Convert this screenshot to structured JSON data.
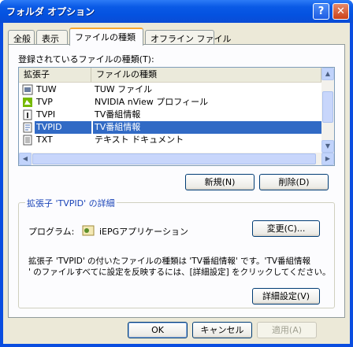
{
  "window": {
    "title": "フォルダ オプション",
    "help_glyph": "?",
    "close_glyph": "✕"
  },
  "tabs": [
    {
      "label": "全般"
    },
    {
      "label": "表示"
    },
    {
      "label": "ファイルの種類",
      "active": true
    },
    {
      "label": "オフライン ファイル"
    }
  ],
  "filetypes": {
    "label": "登録されているファイルの種類(T):",
    "columns": [
      "拡張子",
      "ファイルの種類"
    ],
    "rows": [
      {
        "ext": "TUW",
        "type": "TUW ファイル",
        "icon": "tuw-file-icon"
      },
      {
        "ext": "TVP",
        "type": "NVIDIA nView プロフィール",
        "icon": "nview-icon"
      },
      {
        "ext": "TVPI",
        "type": "TV番組情報",
        "icon": "tvpi-file-icon"
      },
      {
        "ext": "TVPID",
        "type": "TV番組情報",
        "icon": "tvpid-file-icon",
        "selected": true
      },
      {
        "ext": "TXT",
        "type": "テキスト ドキュメント",
        "icon": "text-document-icon"
      }
    ],
    "new_button": "新規(N)",
    "delete_button": "削除(D)"
  },
  "details": {
    "title": "拡張子 'TVPID' の詳細",
    "program_label": "プログラム:",
    "program_name": "iEPGアプリケーション",
    "change_button": "変更(C)...",
    "description_line1": "拡張子 'TVPID' の付いたファイルの種類は 'TV番組情報' です。'TV番組情報",
    "description_line2": "' のファイルすべてに設定を反映するには、[詳細設定] をクリックしてください。",
    "advanced_button": "詳細設定(V)"
  },
  "footer": {
    "ok": "OK",
    "cancel": "キャンセル",
    "apply": "適用(A)"
  },
  "colors": {
    "titlebar": "#0a5ae6",
    "selection": "#316ac5",
    "tab_highlight": "#f7a731"
  }
}
